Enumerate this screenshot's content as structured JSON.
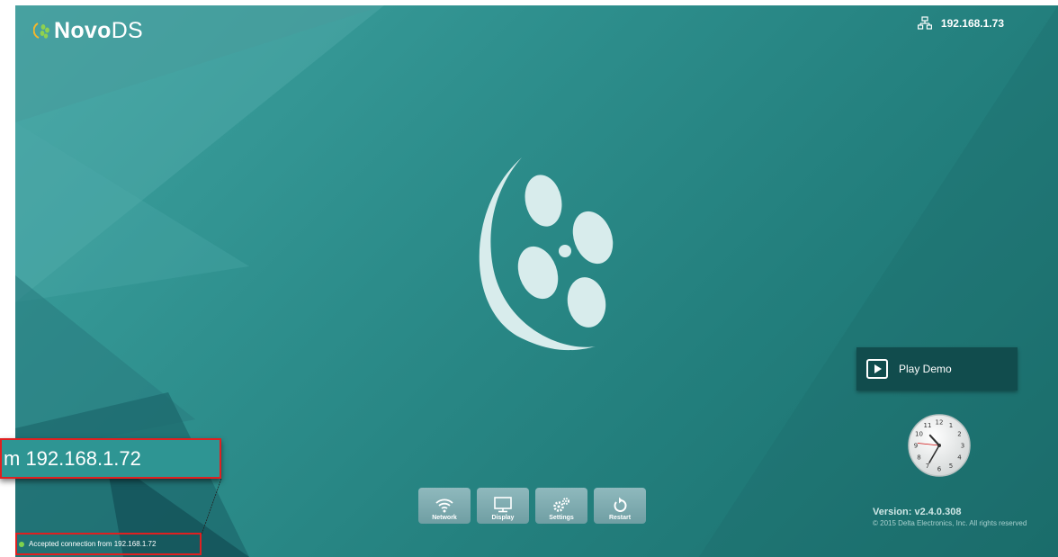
{
  "header": {
    "logo_bold": "Novo",
    "logo_light": "DS",
    "ip_address": "192.168.1.73"
  },
  "play_demo": {
    "label": "Play Demo"
  },
  "clock": {
    "numbers": [
      "12",
      "1",
      "2",
      "3",
      "4",
      "5",
      "6",
      "7",
      "8",
      "9",
      "10",
      "11"
    ],
    "hour": 10,
    "minute": 35,
    "second": 46
  },
  "footer": {
    "version": "Version:  v2.4.0.308",
    "copyright": "© 2015 Delta Electronics, Inc. All rights reserved"
  },
  "toolbar": {
    "items": [
      {
        "label": "Network",
        "icon": "wifi-icon"
      },
      {
        "label": "Display",
        "icon": "monitor-icon"
      },
      {
        "label": "Settings",
        "icon": "gears-icon"
      },
      {
        "label": "Restart",
        "icon": "restart-icon"
      }
    ]
  },
  "status": {
    "message": "Accepted connection from 192.168.1.72",
    "indicator_color": "#7fd34d"
  },
  "callout": {
    "text": "m 192.168.1.72"
  },
  "colors": {
    "background": "#2e8f8d",
    "panel": "#114c4d",
    "highlight": "#e02020"
  }
}
